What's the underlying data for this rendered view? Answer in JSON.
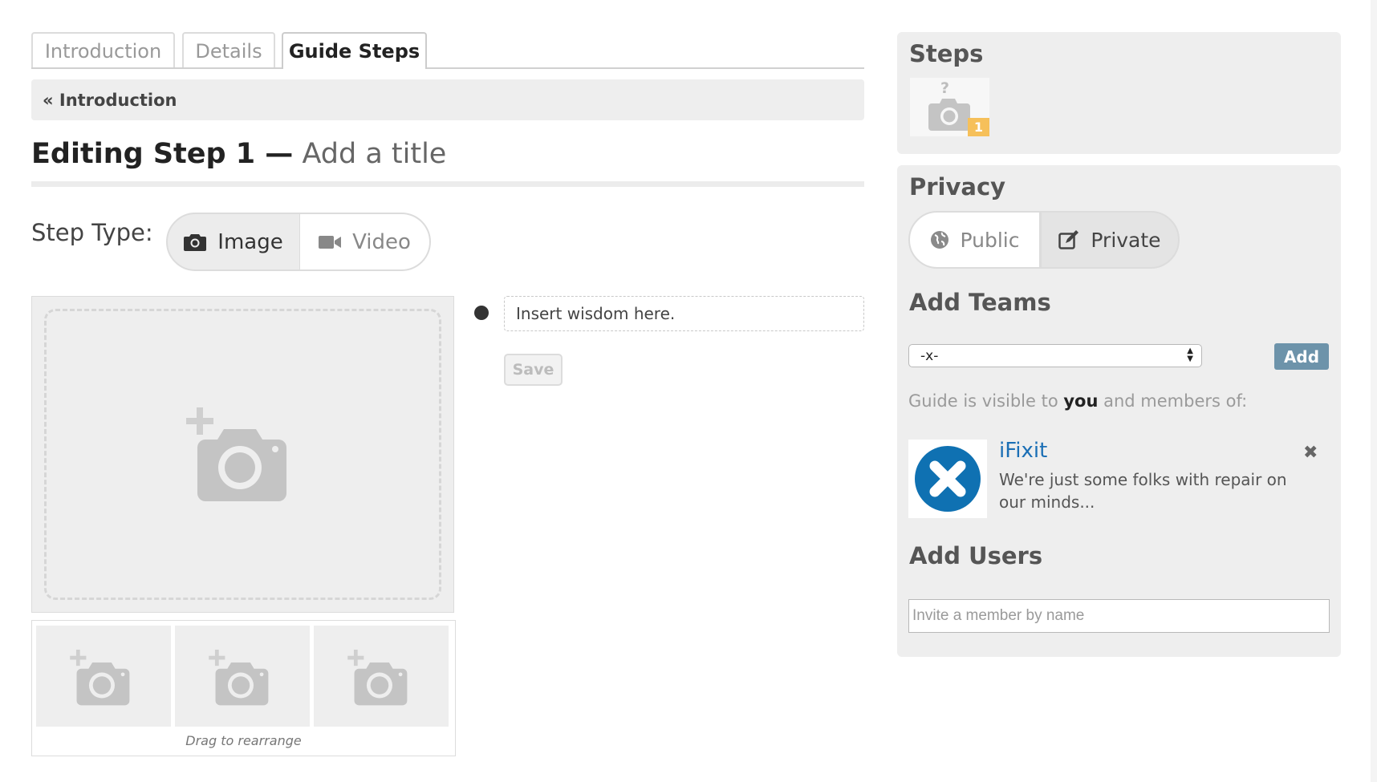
{
  "tabs": [
    {
      "label": "Introduction",
      "active": false
    },
    {
      "label": "Details",
      "active": false
    },
    {
      "label": "Guide Steps",
      "active": true
    }
  ],
  "breadcrumb": {
    "label": "« Introduction"
  },
  "heading": {
    "step": "Editing Step 1 —",
    "title_placeholder": "Add a title"
  },
  "step_type": {
    "label": "Step Type:",
    "image": "Image",
    "video": "Video",
    "selected": "Image"
  },
  "images": {
    "drag_label": "Drag to rearrange"
  },
  "bullet": {
    "placeholder": "Insert wisdom here.",
    "save": "Save"
  },
  "steps_panel": {
    "title": "Steps",
    "thumb_mark": "?",
    "badge": "1"
  },
  "privacy": {
    "title": "Privacy",
    "public": "Public",
    "private": "Private",
    "selected": "Private",
    "add_teams": "Add Teams",
    "select_value": "-x-",
    "add_button": "Add",
    "visible_prefix": "Guide is visible to ",
    "visible_you": "you",
    "visible_suffix": " and members of:",
    "team": {
      "name": "iFixit",
      "description": "We're just some folks with repair on our minds..."
    },
    "add_users": "Add Users",
    "users_placeholder": "Invite a member by name"
  },
  "colors": {
    "accent_blue": "#1b6fb5",
    "button_blue": "#6d93aa",
    "badge_orange": "#f6c05a",
    "panel_gray": "#eeeeee"
  }
}
